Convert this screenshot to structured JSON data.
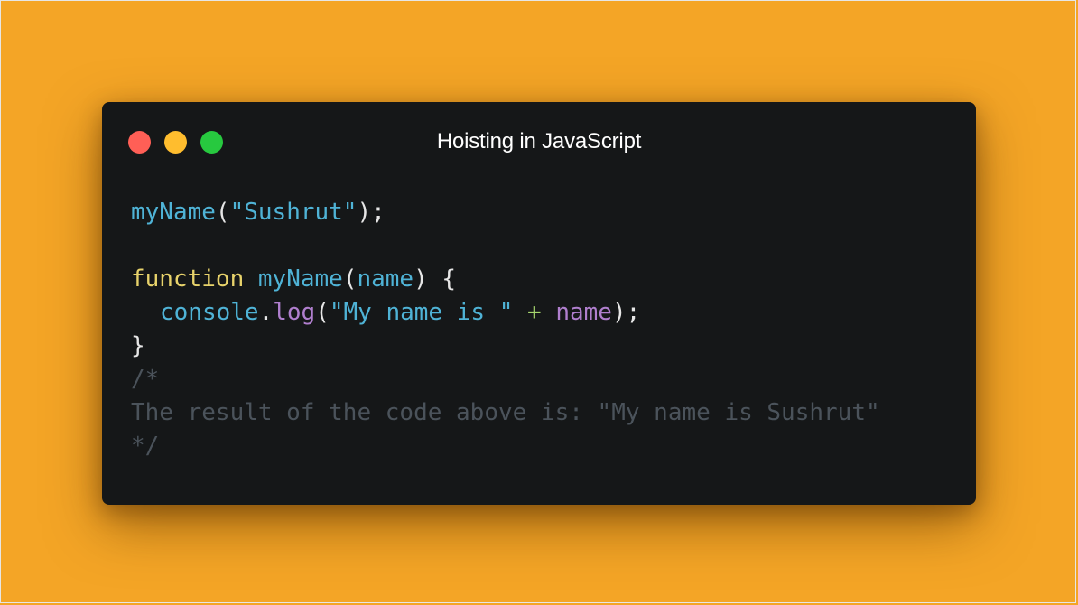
{
  "window": {
    "title": "Hoisting in JavaScript",
    "buttons": {
      "close_color": "#ff5f56",
      "minimize_color": "#ffbd2e",
      "maximize_color": "#27c93f"
    }
  },
  "colors": {
    "background": "#f4a526",
    "window_bg": "#151718",
    "identifier": "#4fb3d6",
    "string": "#4fb3d6",
    "keyword": "#e8d36b",
    "param": "#4fb3d6",
    "purple": "#b07fce",
    "operator": "#a6d66e",
    "punct": "#e6e6e6",
    "comment": "#4b535b"
  },
  "code": {
    "line1": {
      "ident": "myName",
      "open": "(",
      "str": "\"Sushrut\"",
      "close": ");"
    },
    "line3": {
      "kw": "function",
      "space": " ",
      "fn": "myName",
      "open": "(",
      "param": "name",
      "close": ") {"
    },
    "line4": {
      "obj": "console",
      "dot": ".",
      "method": "log",
      "open": "(",
      "str": "\"My name is \"",
      "sp1": " ",
      "op": "+",
      "sp2": " ",
      "var": "name",
      "close": ");"
    },
    "line5": {
      "brace": "}"
    },
    "comment": {
      "open": "/*",
      "text": "The result of the code above is: \"My name is Sushrut\"",
      "close": "*/"
    }
  }
}
